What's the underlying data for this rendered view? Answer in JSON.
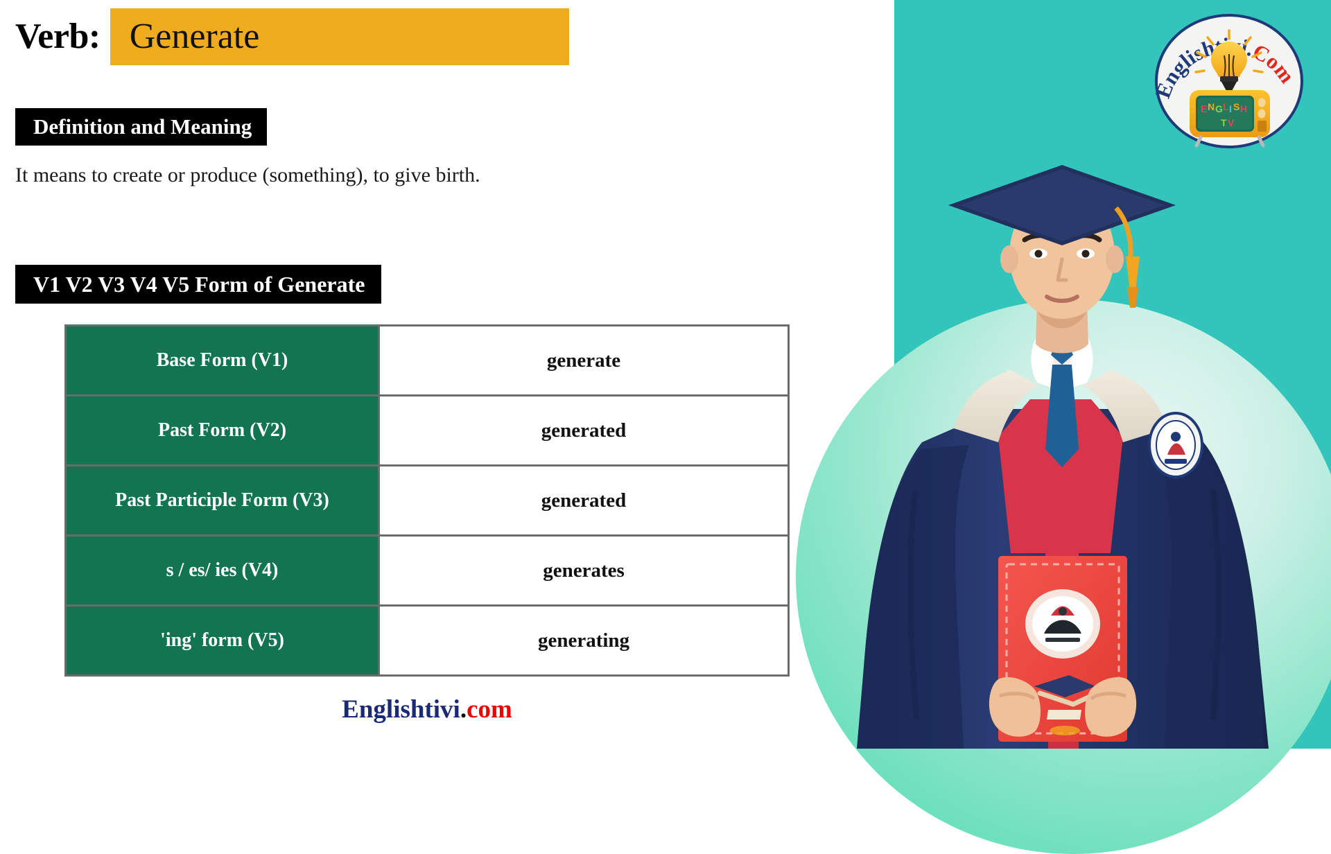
{
  "header": {
    "verb_label": "Verb:",
    "verb_word": "Generate"
  },
  "sections": {
    "definition_heading": "Definition and Meaning",
    "definition_text": "It means to create or produce (something), to give birth.",
    "forms_heading": "V1 V2 V3 V4 V5 Form of Generate"
  },
  "table": {
    "rows": [
      {
        "label": "Base Form (V1)",
        "value": "generate"
      },
      {
        "label": "Past Form (V2)",
        "value": "generated"
      },
      {
        "label": "Past Participle Form (V3)",
        "value": "generated"
      },
      {
        "label": "s / es/ ies (V4)",
        "value": "generates"
      },
      {
        "label": "'ing' form (V5)",
        "value": "generating"
      }
    ]
  },
  "footer": {
    "brand_primary": "Englishtivi",
    "brand_separator": ".",
    "brand_suffix": "com"
  },
  "logo": {
    "text_primary": "Englishtivi.",
    "text_suffix": "Com",
    "screen_text_line1": "ENGLISH",
    "screen_text_line2": "TV"
  },
  "colors": {
    "panel_teal": "#33c4bc",
    "highlight_amber": "#efac1e",
    "table_green": "#127450",
    "table_border": "#6b6b6b",
    "brand_navy": "#1a2a73",
    "brand_red": "#f00000",
    "gown_navy": "#23356b",
    "stole_red": "#d8344a"
  }
}
